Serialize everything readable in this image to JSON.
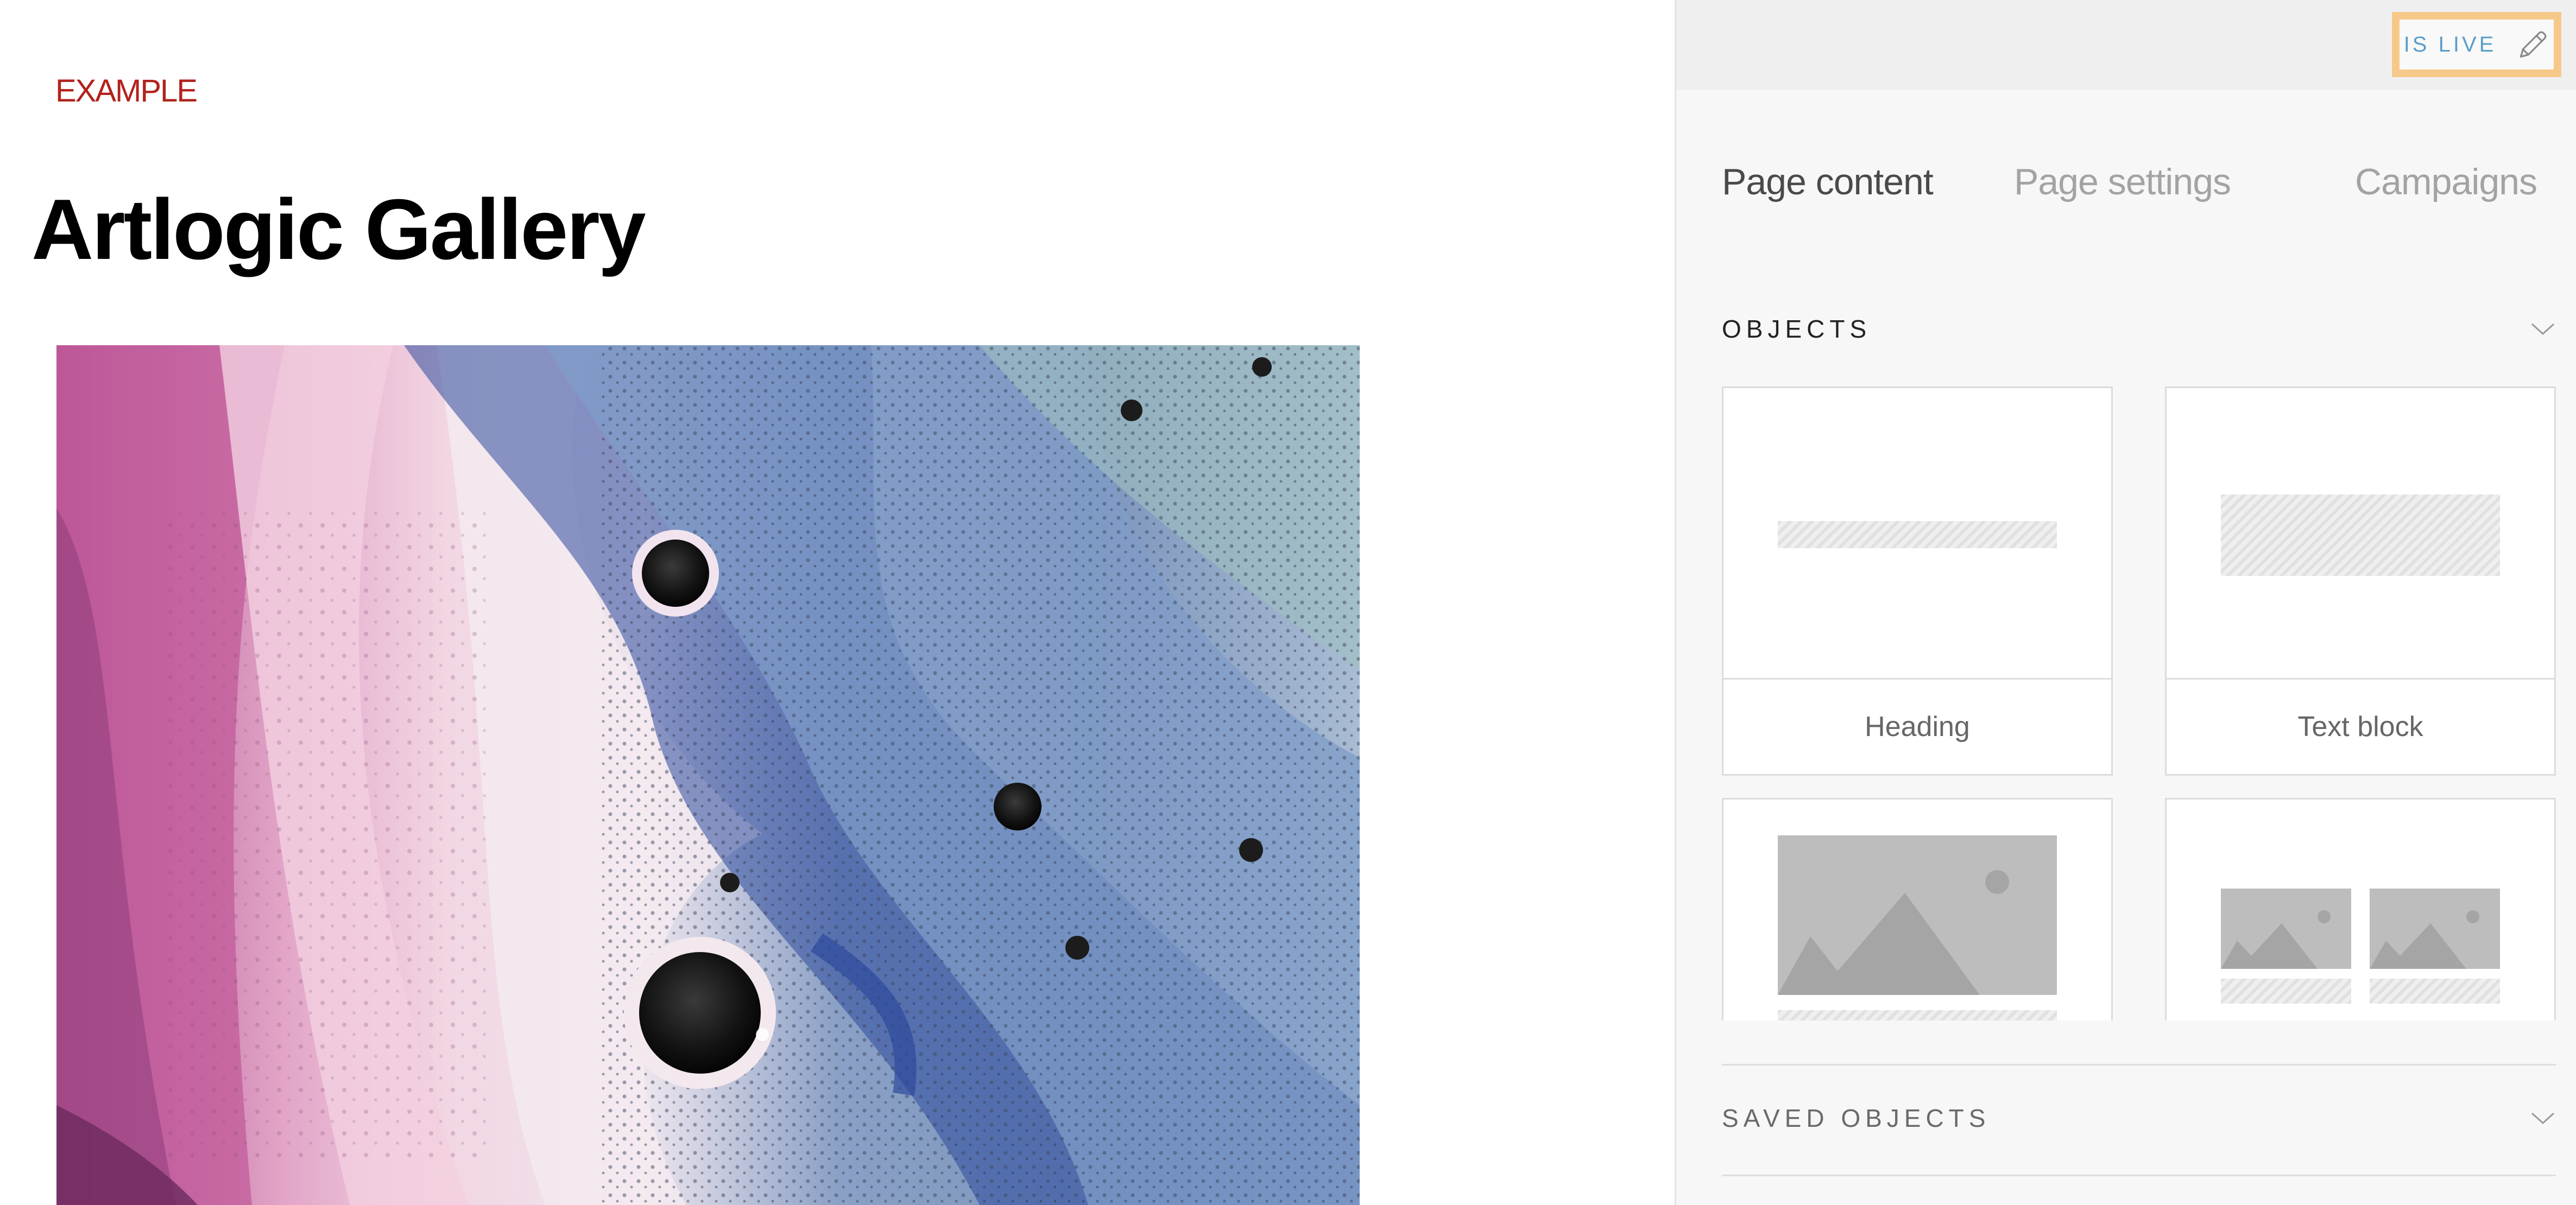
{
  "preview": {
    "eyebrow": "EXAMPLE",
    "title": "Artlogic Gallery",
    "hero_image": "abstract-marbled-paint-image"
  },
  "panel": {
    "status_label": "IS LIVE",
    "status_icon": "pencil-icon",
    "tabs": [
      {
        "label": "Page content",
        "active": true
      },
      {
        "label": "Page settings",
        "active": false
      },
      {
        "label": "Campaigns",
        "active": false
      }
    ],
    "objects": {
      "title": "OBJECTS",
      "items": [
        {
          "label": "Heading"
        },
        {
          "label": "Text block"
        },
        {
          "label": ""
        },
        {
          "label": ""
        }
      ]
    },
    "saved_objects": {
      "title": "SAVED OBJECTS"
    }
  },
  "colors": {
    "eyebrow": "#b2221d",
    "status_text": "#5a9ec9",
    "status_border": "#f6c98a",
    "panel_bg": "#f7f7f7"
  }
}
